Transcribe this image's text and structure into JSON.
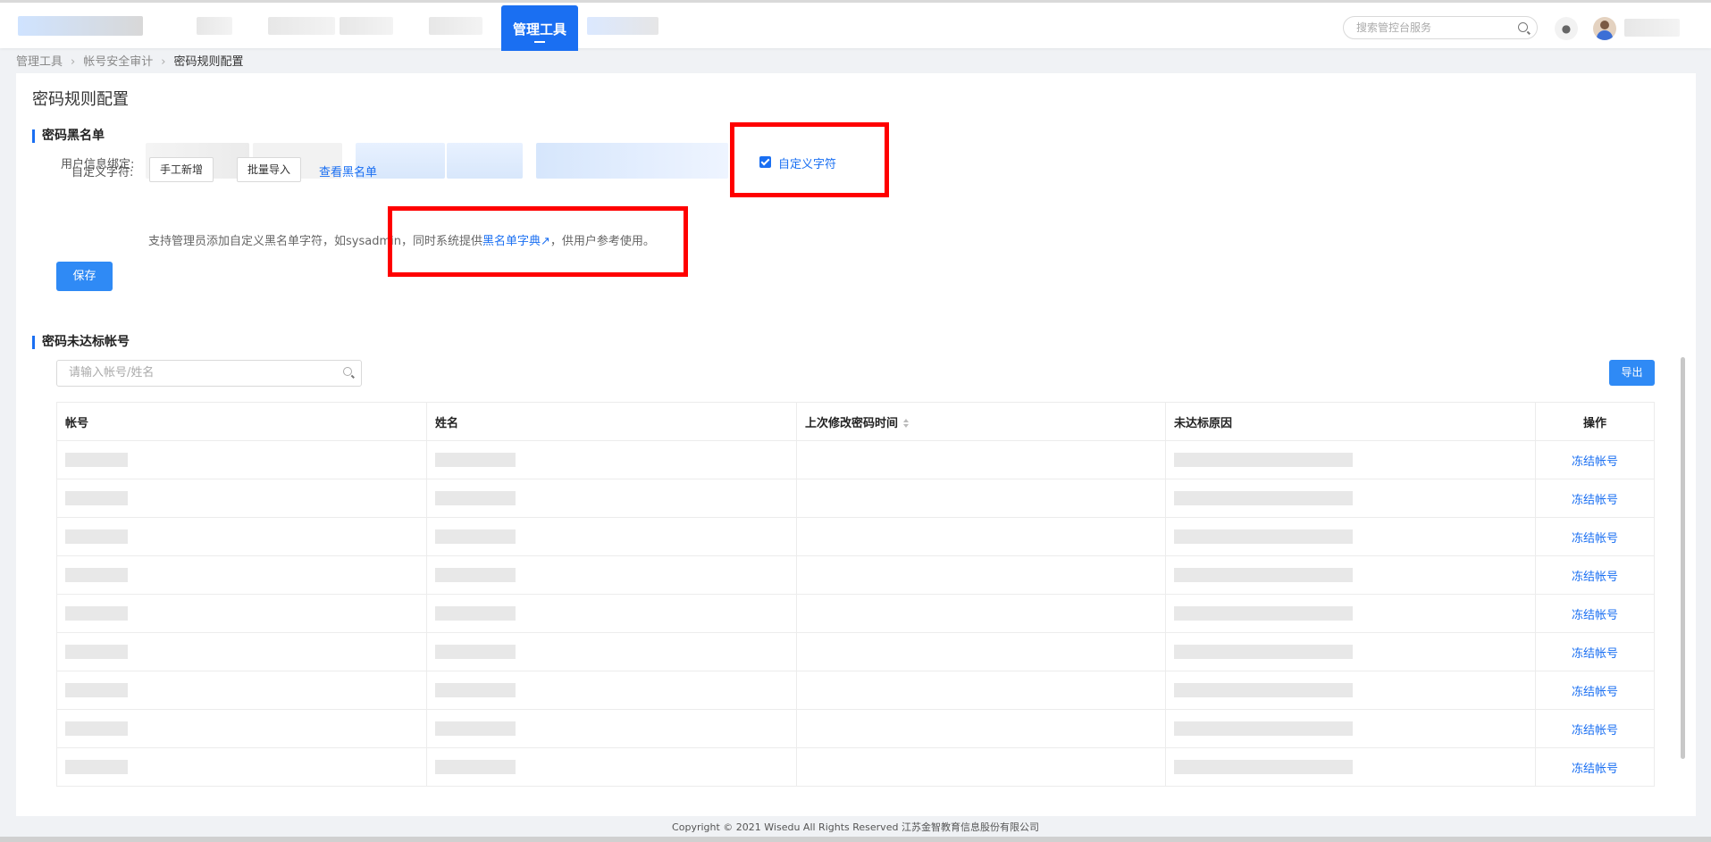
{
  "header": {
    "active_nav": "管理工具",
    "search_placeholder": "搜索管控台服务"
  },
  "breadcrumb": [
    "管理工具",
    "帐号安全审计",
    "密码规则配置"
  ],
  "page_title": "密码规则配置",
  "blacklist": {
    "section_title": "密码黑名单",
    "user_info_label": "用户信息绑定:",
    "custom_checkbox_label": "自定义字符",
    "custom_checkbox_checked": true,
    "custom_label": "自定义字符:",
    "manual_add_button": "手工新增",
    "batch_import_button": "批量导入",
    "view_blacklist_link": "查看黑名单",
    "hint_prefix": "支持管理员添加自定义黑名单字符，如sysadmin，同时系统提供",
    "hint_link": "黑名单字典",
    "hint_suffix": "，供用户参考使用。",
    "save_button": "保存"
  },
  "noncompliant": {
    "section_title": "密码未达标帐号",
    "search_placeholder": "请输入帐号/姓名",
    "export_button": "导出",
    "columns": [
      "帐号",
      "姓名",
      "上次修改密码时间",
      "未达标原因",
      "操作"
    ],
    "rows": [
      {
        "action": "冻结帐号"
      },
      {
        "action": "冻结帐号"
      },
      {
        "action": "冻结帐号"
      },
      {
        "action": "冻结帐号"
      },
      {
        "action": "冻结帐号"
      },
      {
        "action": "冻结帐号"
      },
      {
        "action": "冻结帐号"
      },
      {
        "action": "冻结帐号"
      },
      {
        "action": "冻结帐号"
      }
    ]
  },
  "footer": "Copyright © 2021 Wisedu All Rights Reserved 江苏金智教育信息股份有限公司",
  "colors": {
    "accent": "#1a6ff2",
    "primary_button": "#2f8af5",
    "annotation_red": "#ff0000"
  }
}
